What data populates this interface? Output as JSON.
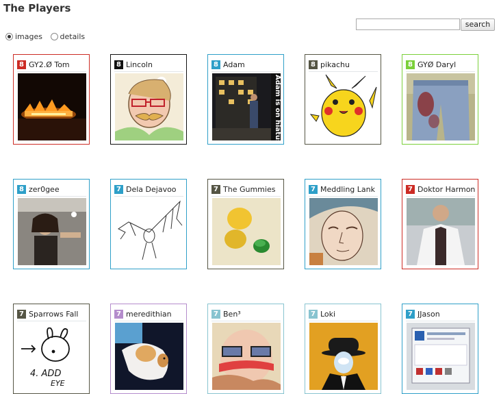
{
  "page": {
    "title": "The Players"
  },
  "search": {
    "placeholder": "",
    "value": "",
    "button_label": "search"
  },
  "view": {
    "options": [
      "images",
      "details"
    ],
    "selected": "images"
  },
  "players": [
    {
      "score": "8",
      "name": "GY2.Ø Tom",
      "color": "#cc2b24",
      "image": "fire-night"
    },
    {
      "score": "8",
      "name": "Lincoln",
      "color": "#111111",
      "image": "sketch-face-glasses"
    },
    {
      "score": "8",
      "name": "Adam",
      "color": "#2e9fc8",
      "image": "night-building"
    },
    {
      "score": "8",
      "name": "pikachu",
      "color": "#555544",
      "image": "pikachu"
    },
    {
      "score": "8",
      "name": "GYØ Daryl",
      "color": "#7bd03a",
      "image": "jeans"
    },
    {
      "score": "8",
      "name": "zer0gee",
      "color": "#2e9fc8",
      "image": "party"
    },
    {
      "score": "7",
      "name": "Dela Dejavoo",
      "color": "#2e9fc8",
      "image": "bat-sketch"
    },
    {
      "score": "7",
      "name": "The Gummies",
      "color": "#555544",
      "image": "gummies"
    },
    {
      "score": "7",
      "name": "Meddling Lank",
      "color": "#2e9fc8",
      "image": "sketch-face"
    },
    {
      "score": "7",
      "name": "Doktor Harmon",
      "color": "#cc2b24",
      "image": "lab-coat"
    },
    {
      "score": "7",
      "name": "Sparrows Fall",
      "color": "#555544",
      "image": "bunny-sketch"
    },
    {
      "score": "7",
      "name": "meredithian",
      "color": "#b48ccc",
      "image": "cat"
    },
    {
      "score": "7",
      "name": "Ben³",
      "color": "#88c4d0",
      "image": "painted-face"
    },
    {
      "score": "7",
      "name": "Loki",
      "color": "#88c4d0",
      "image": "bowler-hat"
    },
    {
      "score": "7",
      "name": "JJason",
      "color": "#2e9fc8",
      "image": "screen"
    }
  ]
}
